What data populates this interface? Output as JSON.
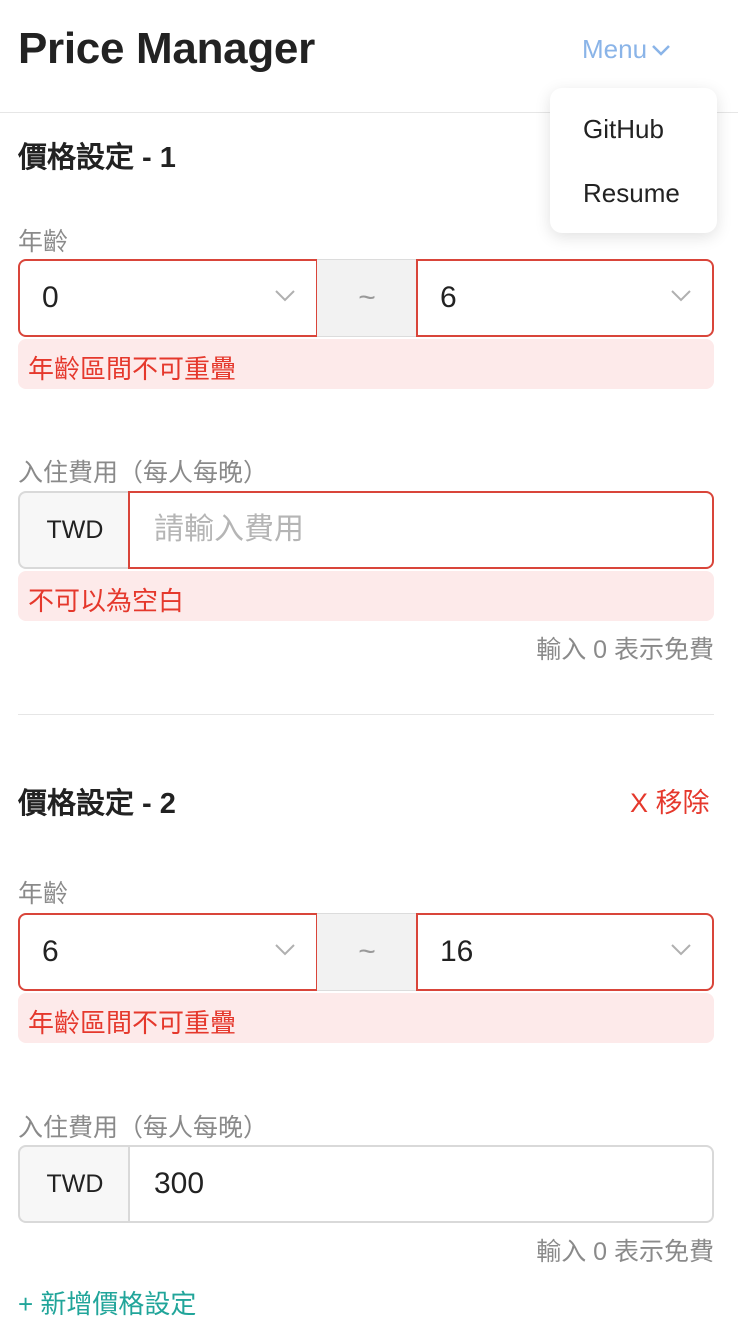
{
  "app": {
    "title": "Price Manager"
  },
  "menu": {
    "toggle_label": "Menu",
    "items": [
      {
        "label": "GitHub"
      },
      {
        "label": "Resume"
      }
    ]
  },
  "colors": {
    "error": "#e5382c",
    "accent_link": "#8ab4e8",
    "add_link": "#21a59a"
  },
  "price_settings": [
    {
      "title": "價格設定 - 1",
      "age_label": "年齡",
      "age_start": "0",
      "age_separator": "~",
      "age_end": "6",
      "age_error": "年齡區間不可重疊",
      "fee_label": "入住費用（每人每晚）",
      "currency": "TWD",
      "fee_value": "",
      "fee_placeholder": "請輸入費用",
      "fee_error": "不可以為空白",
      "fee_hint": "輸入 0 表示免費"
    },
    {
      "title": "價格設定 - 2",
      "remove_label": "X 移除",
      "age_label": "年齡",
      "age_start": "6",
      "age_separator": "~",
      "age_end": "16",
      "age_error": "年齡區間不可重疊",
      "fee_label": "入住費用（每人每晚）",
      "currency": "TWD",
      "fee_value": "300",
      "fee_hint": "輸入 0 表示免費"
    }
  ],
  "add_label": "+ 新增價格設定"
}
